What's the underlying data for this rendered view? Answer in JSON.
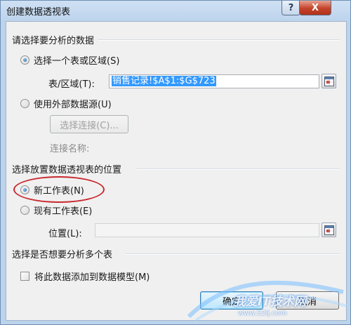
{
  "window": {
    "title": "创建数据透视表",
    "help_label": "?",
    "close_label": "X"
  },
  "source_section": {
    "heading": "请选择要分析的数据",
    "option_table": {
      "label": "选择一个表或区域(S)",
      "selected": true
    },
    "range": {
      "label": "表/区域(T):",
      "value": "销售记录!$A$1:$G$723"
    },
    "option_external": {
      "label": "使用外部数据源(U)",
      "selected": false
    },
    "choose_connection_label": "选择连接(C)...",
    "connection_name_label": "连接名称:"
  },
  "placement_section": {
    "heading": "选择放置数据透视表的位置",
    "option_new": {
      "label": "新工作表(N)",
      "selected": true
    },
    "option_existing": {
      "label": "现有工作表(E)",
      "selected": false
    },
    "location": {
      "label": "位置(L):",
      "value": ""
    }
  },
  "multi_section": {
    "heading": "选择是否想要分析多个表",
    "add_to_model": {
      "label": "将此数据添加到数据模型(M)",
      "checked": false
    }
  },
  "buttons": {
    "ok_label": "确定",
    "cancel_label": "取消"
  },
  "watermark": {
    "text": "我爱IT技术网",
    "sub": "www.52ij.com"
  },
  "colors": {
    "highlight_ring": "#c8282e",
    "selection": "#3399ff",
    "close_button": "#c4432a"
  }
}
